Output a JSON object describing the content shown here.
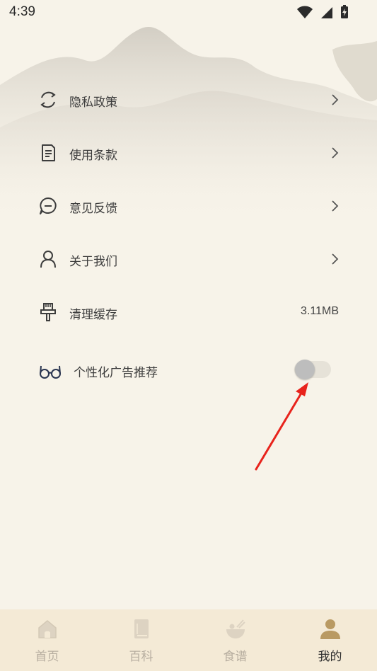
{
  "status_bar": {
    "time": "4:39",
    "icons": [
      "wifi-icon",
      "signal-icon",
      "battery-charging-icon"
    ]
  },
  "menu": {
    "items": [
      {
        "label": "隐私政策",
        "icon": "refresh-circle-icon",
        "has_chevron": true
      },
      {
        "label": "使用条款",
        "icon": "document-icon",
        "has_chevron": true
      },
      {
        "label": "意见反馈",
        "icon": "chat-bubble-icon",
        "has_chevron": true
      },
      {
        "label": "关于我们",
        "icon": "user-icon",
        "has_chevron": true
      },
      {
        "label": "清理缓存",
        "icon": "brush-icon",
        "value": "3.11MB"
      }
    ],
    "ad_toggle": {
      "label": "个性化广告推荐",
      "icon": "glasses-icon",
      "enabled": false
    }
  },
  "bottom_nav": {
    "tabs": [
      {
        "label": "首页",
        "icon": "home-icon",
        "active": false
      },
      {
        "label": "百科",
        "icon": "book-icon",
        "active": false
      },
      {
        "label": "食谱",
        "icon": "bowl-icon",
        "active": false
      },
      {
        "label": "我的",
        "icon": "profile-icon",
        "active": true
      }
    ]
  },
  "colors": {
    "background": "#f7f3e9",
    "nav_background": "#f4ead6",
    "active_tab": "#2e2e2e",
    "inactive_tab": "#b7aea0",
    "active_icon": "#b99a63",
    "annotation_arrow": "#e8231c"
  }
}
